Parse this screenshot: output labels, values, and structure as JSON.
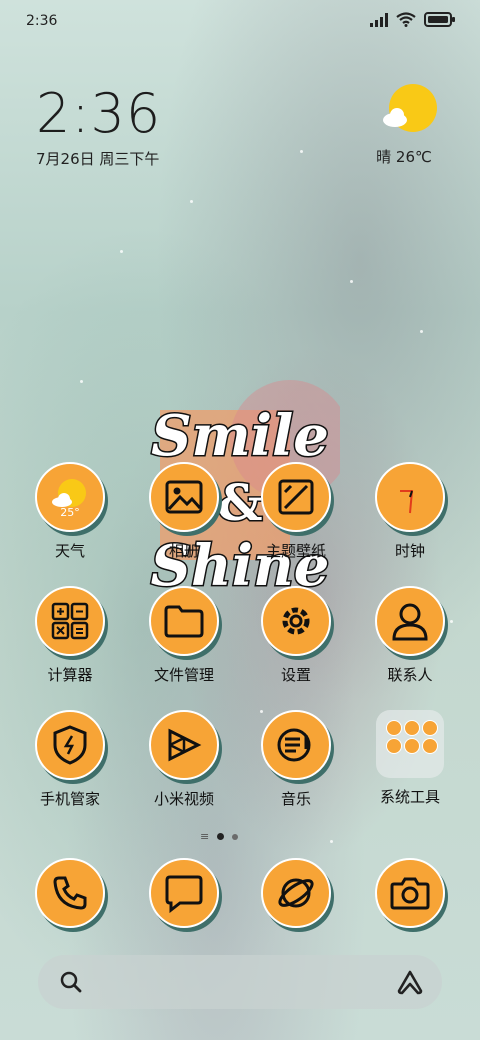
{
  "status_bar": {
    "time": "2:36",
    "battery": "battery-icon"
  },
  "lock_widget": {
    "clock": "2:36",
    "date": "7月26日 周三下午"
  },
  "weather_widget": {
    "text": "晴 26℃"
  },
  "artwork": {
    "line1": "Smile",
    "line2": "&",
    "line3": "Shine"
  },
  "apps_row1": [
    {
      "label": "天气",
      "badge": "25°"
    },
    {
      "label": "相册"
    },
    {
      "label": "主题壁纸"
    },
    {
      "label": "时钟"
    }
  ],
  "apps_row2": [
    {
      "label": "计算器"
    },
    {
      "label": "文件管理"
    },
    {
      "label": "设置"
    },
    {
      "label": "联系人"
    }
  ],
  "apps_row3": [
    {
      "label": "手机管家"
    },
    {
      "label": "小米视频"
    },
    {
      "label": "音乐"
    },
    {
      "label": "系统工具"
    }
  ],
  "dock": [
    "phone-icon",
    "message-icon",
    "browser-icon",
    "camera-icon"
  ],
  "colors": {
    "accent": "#f7a436",
    "shadow": "#3f6f6a"
  }
}
